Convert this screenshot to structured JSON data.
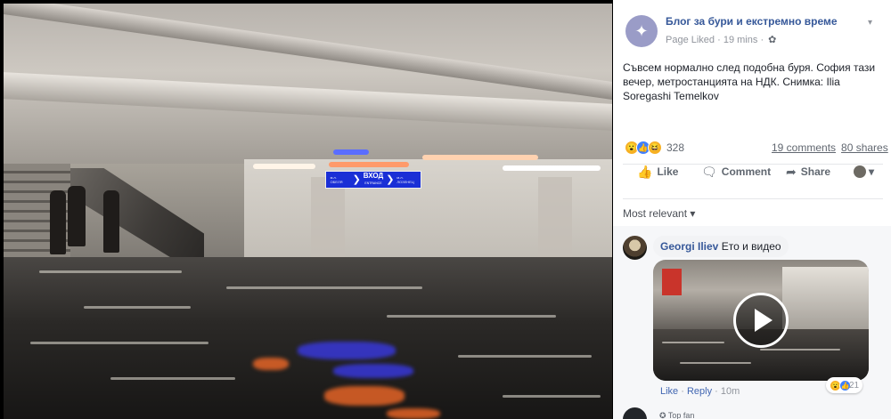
{
  "photo": {
    "sign": {
      "left_small": "м.л. ОБЕЛЯ",
      "main": "ВХОД",
      "main_sub": "ENTRANCE",
      "right_small": "м.л. ЛОЗЕНЕЦ"
    }
  },
  "post": {
    "page_name": "Блог за бури и екстремно време",
    "page_liked": "Page Liked",
    "time": "19 mins",
    "text": "Съвсем нормално след подобна буря. София тази вечер, метростанцията на НДК. Снимка: Ilia Soregashi Temelkov",
    "reaction_count": "328",
    "comments_count": "19 comments",
    "shares_count": "80 shares"
  },
  "actions": {
    "like": "Like",
    "comment": "Comment",
    "share": "Share"
  },
  "comments_filter": "Most relevant",
  "comment": {
    "author": "Georgi Iliev",
    "text": "Ето и видео",
    "like": "Like",
    "reply": "Reply",
    "time": "10m",
    "reaction_count": "21"
  },
  "next_comment": {
    "label": "Top fan"
  },
  "colors": {
    "link_blue": "#365899",
    "meta_gray": "#90949c",
    "sign_blue": "#1a2fd6"
  }
}
